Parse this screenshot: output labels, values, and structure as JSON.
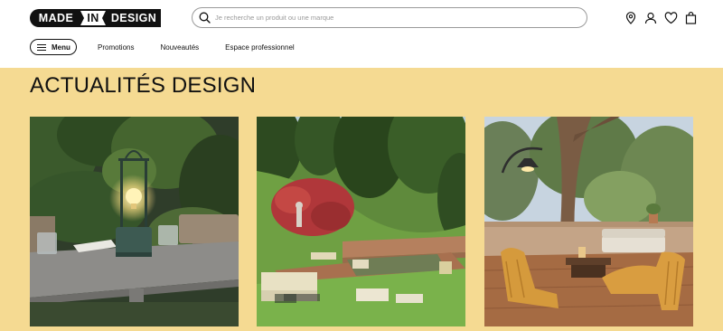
{
  "logo": {
    "made": "MADE",
    "in": "IN",
    "design": "DESIGN"
  },
  "search": {
    "placeholder": "Je recherche un produit ou une marque",
    "icon": "search-icon"
  },
  "top_icons": [
    "location-pin-icon",
    "user-icon",
    "heart-icon",
    "shopping-bag-icon"
  ],
  "nav": {
    "menu_label": "Menu",
    "links": [
      "Promotions",
      "Nouveautés",
      "Espace professionnel"
    ]
  },
  "news": {
    "title": "ACTUALITÉS DESIGN",
    "background": "#f5da92"
  },
  "cards": [
    {
      "image": "outdoor-table-lamp-photo"
    },
    {
      "image": "garden-pool-lounge-photo"
    },
    {
      "image": "terrace-lounge-chairs-photo"
    }
  ]
}
